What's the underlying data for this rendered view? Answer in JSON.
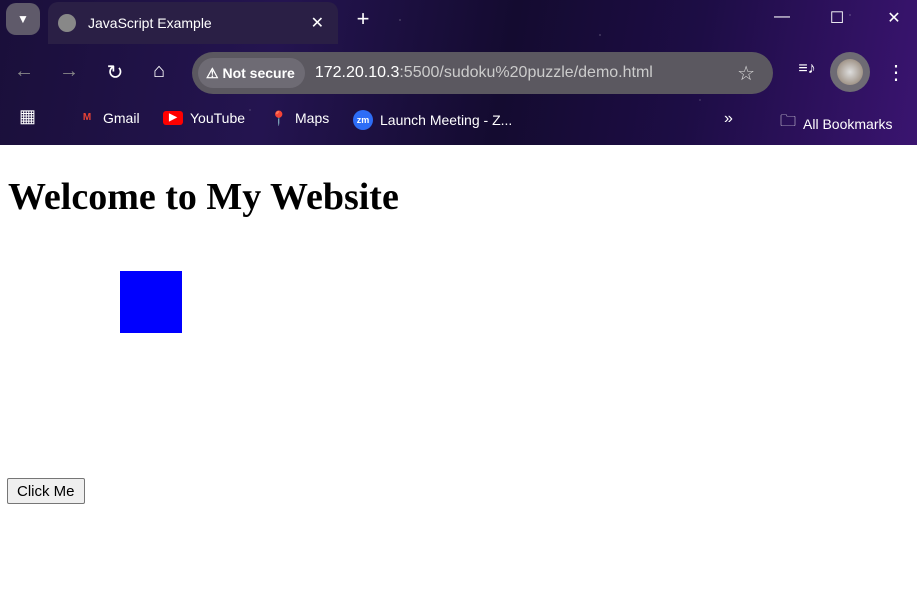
{
  "browser": {
    "tab": {
      "title": "JavaScript Example",
      "close": "✕"
    },
    "new_tab": "+",
    "address": {
      "security": "Not secure",
      "host": "172.20.10.3",
      "path": ":5500/sudoku%20puzzle/demo.html"
    },
    "bookmarks": [
      {
        "label": "Gmail",
        "icon": "gmail-icon"
      },
      {
        "label": "YouTube",
        "icon": "youtube-icon"
      },
      {
        "label": "Maps",
        "icon": "maps-icon"
      },
      {
        "label": "Launch Meeting - Z...",
        "icon": "zoom-icon"
      }
    ],
    "all_bookmarks": "All Bookmarks"
  },
  "page": {
    "heading": "Welcome to My Website",
    "box_color": "#0000ff",
    "button_label": "Click Me"
  }
}
